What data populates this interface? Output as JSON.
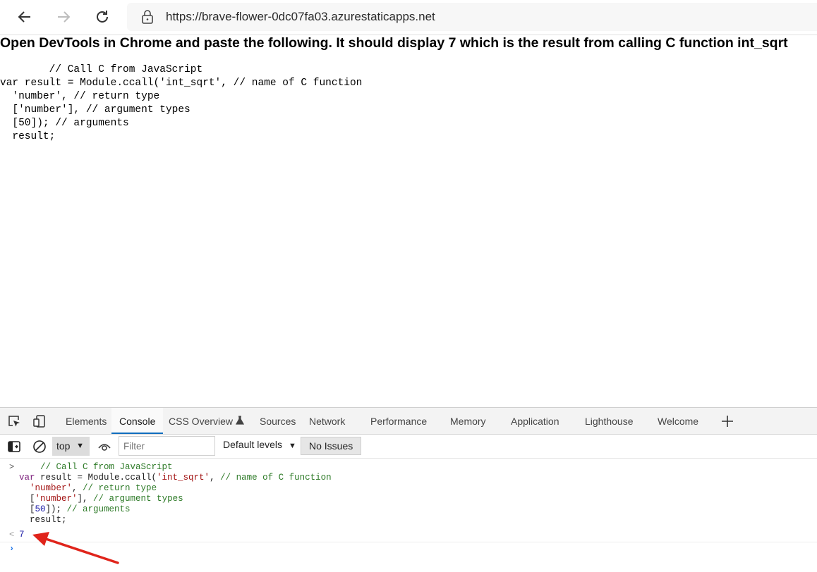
{
  "browser": {
    "url": "https://brave-flower-0dc07fa03.azurestaticapps.net"
  },
  "page": {
    "heading": "Open DevTools in Chrome and paste the following. It should display 7 which is the result from calling C function int_sqrt",
    "code": "        // Call C from JavaScript\nvar result = Module.ccall('int_sqrt', // name of C function\n  'number', // return type\n  ['number'], // argument types\n  [50]); // arguments\n  result;"
  },
  "devtools": {
    "tabs": [
      {
        "label": "Elements"
      },
      {
        "label": "Console"
      },
      {
        "label": "CSS Overview"
      },
      {
        "label": "Sources"
      },
      {
        "label": "Network"
      },
      {
        "label": "Performance"
      },
      {
        "label": "Memory"
      },
      {
        "label": "Application"
      },
      {
        "label": "Lighthouse"
      },
      {
        "label": "Welcome"
      }
    ],
    "active_tab": "Console",
    "context": "top",
    "filter_placeholder": "Filter",
    "levels": "Default levels",
    "issues": "No Issues",
    "console": {
      "input_prompt": ">",
      "result_prompt": "<",
      "result_value": "7"
    }
  },
  "colors": {
    "accent": "#0f6cbd",
    "annotation_arrow": "#e0241b"
  },
  "icons": [
    "back-arrow-icon",
    "forward-arrow-icon",
    "refresh-icon",
    "lock-icon",
    "inspect-element-icon",
    "device-emulation-icon",
    "flask-icon",
    "add-tab-icon",
    "sidebar-toggle-icon",
    "clear-console-icon",
    "live-expression-eye-icon",
    "dropdown-caret-icon"
  ]
}
